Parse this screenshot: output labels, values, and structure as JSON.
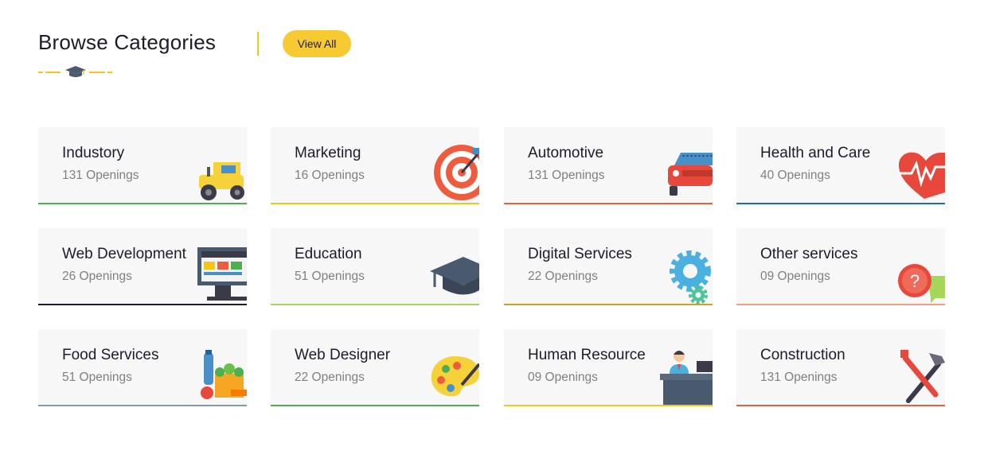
{
  "header": {
    "title": "Browse Categories",
    "view_all_label": "View All"
  },
  "colors": {
    "accent": "#f7ca33",
    "title": "#1c1c2b",
    "muted": "#808080",
    "card_bg": "#f7f7f7"
  },
  "categories": [
    {
      "name": "Industory",
      "openings": "131 Openings",
      "bar_color": "#4caf50",
      "icon": "bulldozer-icon"
    },
    {
      "name": "Marketing",
      "openings": "16 Openings",
      "bar_color": "#f5c518",
      "icon": "target-icon"
    },
    {
      "name": "Automotive",
      "openings": "131 Openings",
      "bar_color": "#ef5b3d",
      "icon": "car-icon"
    },
    {
      "name": "Health and Care",
      "openings": "40 Openings",
      "bar_color": "#1e6fa8",
      "icon": "heart-pulse-icon"
    },
    {
      "name": "Web Development",
      "openings": "26 Openings",
      "bar_color": "#1c1c2b",
      "icon": "monitor-icon"
    },
    {
      "name": "Education",
      "openings": "51 Openings",
      "bar_color": "#a5d65a",
      "icon": "graduation-cap-icon"
    },
    {
      "name": "Digital Services",
      "openings": "22 Openings",
      "bar_color": "#c9a227",
      "icon": "gears-icon"
    },
    {
      "name": "Other services",
      "openings": "09 Openings",
      "bar_color": "#f0a080",
      "icon": "question-bubble-icon"
    },
    {
      "name": "Food Services",
      "openings": "51 Openings",
      "bar_color": "#7aa0a8",
      "icon": "groceries-icon"
    },
    {
      "name": "Web Designer",
      "openings": "22 Openings",
      "bar_color": "#4caf50",
      "icon": "palette-icon"
    },
    {
      "name": "Human Resource",
      "openings": "09 Openings",
      "bar_color": "#f5c518",
      "icon": "receptionist-icon"
    },
    {
      "name": "Construction",
      "openings": "131 Openings",
      "bar_color": "#ef5b3d",
      "icon": "hammer-wrench-icon"
    }
  ]
}
